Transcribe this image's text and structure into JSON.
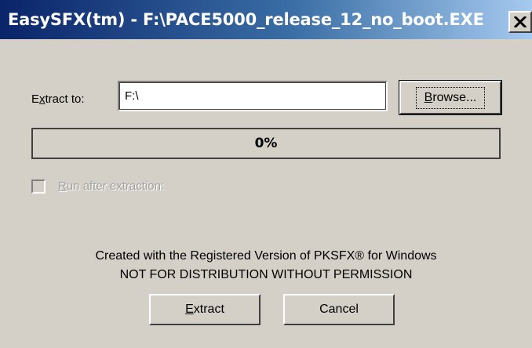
{
  "window": {
    "title": "EasySFX(tm) - F:\\PACE5000_release_12_no_boot.EXE",
    "close_icon": "close-x-icon"
  },
  "extract": {
    "label_prefix": "E",
    "label_accel": "x",
    "label_suffix": "tract to:",
    "path_value": "F:\\",
    "browse_prefix": "",
    "browse_accel": "B",
    "browse_suffix": "rowse..."
  },
  "progress": {
    "text": "0%",
    "value": 0
  },
  "run_after": {
    "accel": "R",
    "label_suffix": "un after extraction:",
    "checked": false,
    "enabled": false
  },
  "info": {
    "line1": "Created with the Registered Version of PKSFX® for Windows",
    "line2": "NOT FOR DISTRIBUTION WITHOUT PERMISSION"
  },
  "buttons": {
    "extract_accel": "E",
    "extract_suffix": "xtract",
    "cancel_label": "Cancel"
  },
  "colors": {
    "title_bar_start": "#0a246a",
    "title_bar_end": "#a6caf0",
    "face": "#d4d0c8",
    "disabled_text": "#a0a0a0"
  }
}
